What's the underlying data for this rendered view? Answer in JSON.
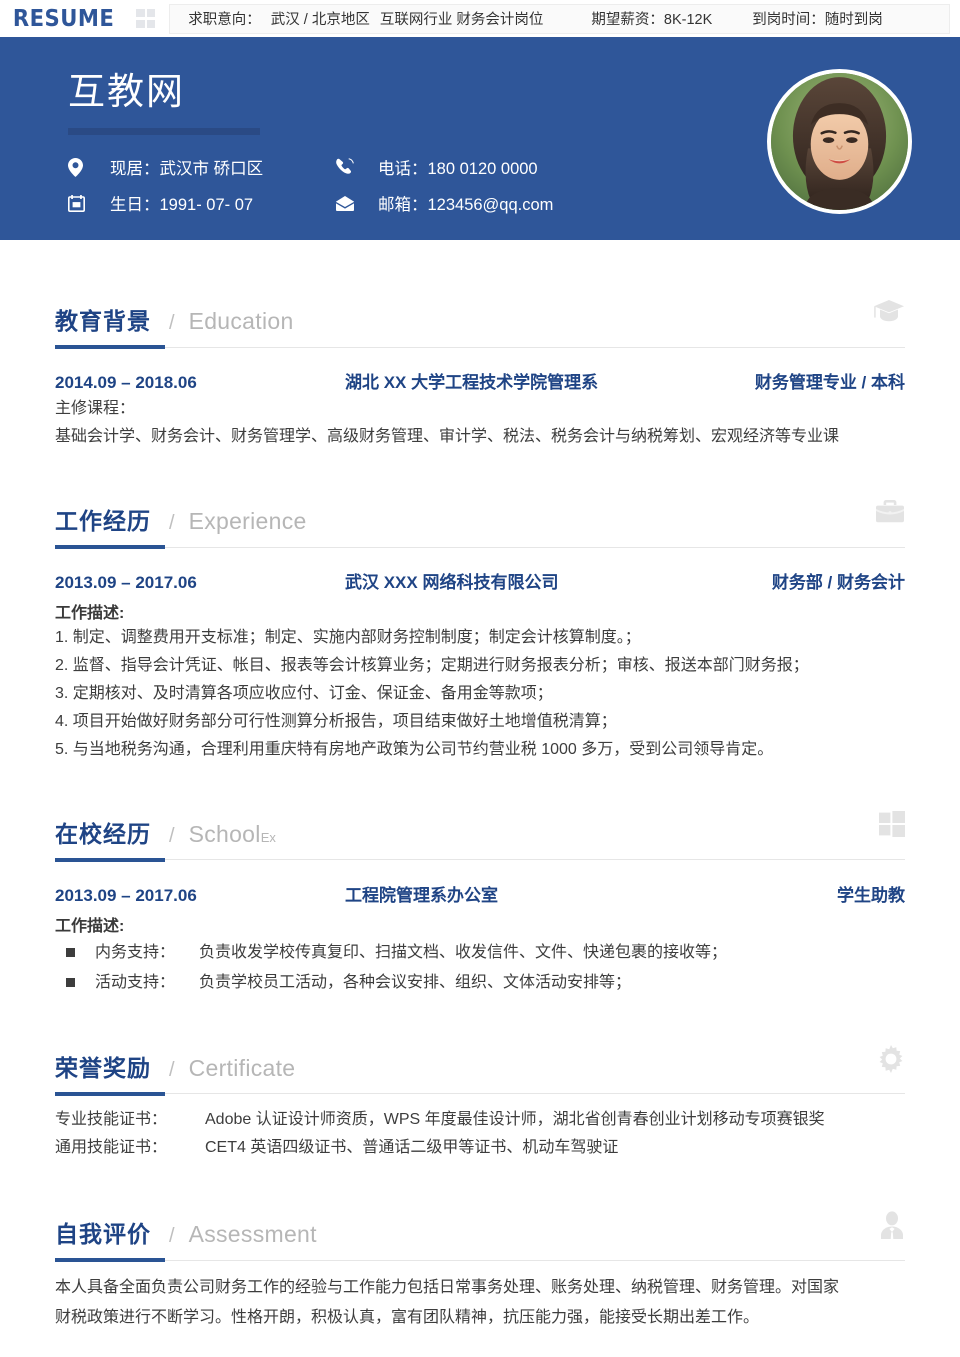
{
  "topbar": {
    "logo": "RESUME",
    "grid_icon": "grid-icon",
    "objective_label": "求职意向：",
    "objective_value": "武汉 / 北京地区",
    "industry": "互联网行业 财务会计岗位",
    "salary": "期望薪资：8K-12K",
    "availability": "到岗时间：随时到岗"
  },
  "hero": {
    "name": "互教网",
    "photo_alt": "portrait-photo",
    "contacts": [
      {
        "icon": "location-pin-icon",
        "text": "现居：武汉市 硚口区"
      },
      {
        "icon": "phone-icon",
        "text": "电话：180 0120 0000"
      },
      {
        "icon": "calendar-icon",
        "text": "生日：1991- 07- 07"
      },
      {
        "icon": "envelope-icon",
        "text": "邮箱：123456@qq.com"
      }
    ]
  },
  "sections": {
    "education": {
      "title_cn": "教育背景",
      "title_en": "Education",
      "icon": "graduation-cap-icon",
      "entry": {
        "date": "2014.09 – 2018.06",
        "org": "湖北 XX 大学工程技术学院管理系",
        "role": "财务管理专业 / 本科"
      },
      "courses_label": "主修课程：",
      "courses": "基础会计学、财务会计、财务管理学、高级财务管理、审计学、税法、税务会计与纳税筹划、宏观经济等专业课"
    },
    "experience": {
      "title_cn": "工作经历",
      "title_en": "Experience",
      "icon": "briefcase-icon",
      "entry": {
        "date": "2013.09 – 2017.06",
        "org": "武汉 XXX 网络科技有限公司",
        "role": "财务部 / 财务会计"
      },
      "desc_label": "工作描述:",
      "items": [
        "1. 制定、调整费用开支标准；制定、实施内部财务控制制度；制定会计核算制度。；",
        "2. 监督、指导会计凭证、帐目、报表等会计核算业务；定期进行财务报表分析；审核、报送本部门财务报；",
        "3. 定期核对、及时清算各项应收应付、订金、保证金、备用金等款项；",
        "4. 项目开始做好财务部分可行性测算分析报告，项目结束做好土地增值税清算；",
        "5. 与当地税务沟通，合理利用重庆特有房地产政策为公司节约营业税 1000 多万，受到公司领导肯定。"
      ]
    },
    "school": {
      "title_cn": "在校经历",
      "title_en": "School",
      "title_en_sub": "Ex",
      "icon": "window-grid-icon",
      "entry": {
        "date": "2013.09 – 2017.06",
        "org": "工程院管理系办公室",
        "role": "学生助教"
      },
      "desc_label": "工作描述:",
      "items": [
        {
          "label": "内务支持：",
          "text": "负责收发学校传真复印、扫描文档、收发信件、文件、快递包裹的接收等；"
        },
        {
          "label": "活动支持：",
          "text": "负责学校员工活动，各种会议安排、组织、文体活动安排等；"
        }
      ]
    },
    "certificate": {
      "title_cn": "荣誉奖励",
      "title_en": "Certificate",
      "icon": "gear-icon",
      "rows": [
        {
          "key": "专业技能证书：",
          "value": "Adobe 认证设计师资质，WPS 年度最佳设计师，湖北省创青春创业计划移动专项赛银奖"
        },
        {
          "key": "通用技能证书：",
          "value": "CET4 英语四级证书、普通话二级甲等证书、机动车驾驶证"
        }
      ]
    },
    "assessment": {
      "title_cn": "自我评价",
      "title_en": "Assessment",
      "icon": "person-suit-icon",
      "lines": [
        "本人具备全面负责公司财务工作的经验与工作能力包括日常事务处理、账务处理、纳税管理、财务管理。对国家",
        "财税政策进行不断学习。性格开朗，积极认真，富有团队精神，抗压能力强，能接受长期出差工作。"
      ]
    }
  },
  "colors": {
    "brand_blue": "#2f5699",
    "heading_blue": "#1f4485",
    "rule_blue": "#2a5494",
    "icon_gray": "#e3e3e3"
  }
}
